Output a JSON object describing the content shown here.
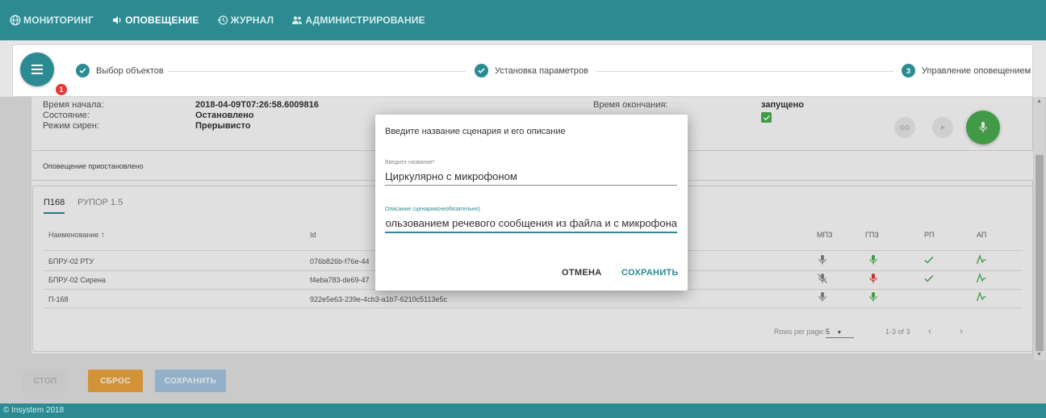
{
  "nav": {
    "items": [
      {
        "label": "МОНИТОРИНГ",
        "icon": "globe-icon"
      },
      {
        "label": "ОПОВЕЩЕНИЕ",
        "icon": "speaker-icon"
      },
      {
        "label": "ЖУРНАЛ",
        "icon": "history-icon"
      },
      {
        "label": "АДМИНИСТРИРОВАНИЕ",
        "icon": "users-icon"
      }
    ],
    "active": "ОПОВЕЩЕНИЕ"
  },
  "stepper": {
    "badge": "1",
    "steps": [
      {
        "label": "Выбор объектов",
        "state": "done"
      },
      {
        "label": "Установка параметров",
        "state": "done"
      },
      {
        "label": "Управление оповещением",
        "state": "current",
        "number": "3"
      }
    ]
  },
  "info": {
    "start_label": "Время начала:",
    "start_value": "2018-04-09T07:26:58.6009816",
    "state_label": "Состояние:",
    "state_value": "Остановлено",
    "siren_label": "Режим сирен:",
    "siren_value": "Прерывисто",
    "end_label": "Время окончания:",
    "status_value": "запущено",
    "go_label": "GO"
  },
  "notice": "Оповещение приостановлено",
  "tabs": [
    "П168",
    "РУПОР 1.5"
  ],
  "table": {
    "columns": [
      "Наименование",
      "Id",
      "МПЗ",
      "ГПЗ",
      "РП",
      "АП"
    ],
    "rows": [
      {
        "name": "БПРУ-02 РТУ",
        "id": "076b826b-f76e-44"
      },
      {
        "name": "БПРУ-02 Сирена",
        "id": "f4eba783-de69-47"
      },
      {
        "name": "П-168",
        "id": "922e5e63-239e-4cb3-a1b7-6210c5113e5c"
      }
    ],
    "rows_per_page_label": "Rows per page:",
    "rows_per_page": "5",
    "range": "1-3 of 3"
  },
  "buttons": {
    "stop": "СТОП",
    "reset": "СБРОС",
    "save": "СОХРАНИТЬ"
  },
  "footer": "© Insystem 2018",
  "dialog": {
    "title": "Введите название сценария и его описание",
    "name_label": "Введите название*",
    "name_value": "Циркулярно с микрофоном",
    "desc_label": "Описание сценария(необязательно)",
    "desc_value": "Циркулярное оповещение с использованием речевого сообщения из файла и с микрофона",
    "cancel": "ОТМЕНА",
    "save": "СОХРАНИТЬ"
  },
  "colors": {
    "accent": "#2c8b92",
    "success": "#4caf50",
    "danger": "#e53935",
    "warning": "#f0a840",
    "save_disabled": "#a7c9e6"
  }
}
